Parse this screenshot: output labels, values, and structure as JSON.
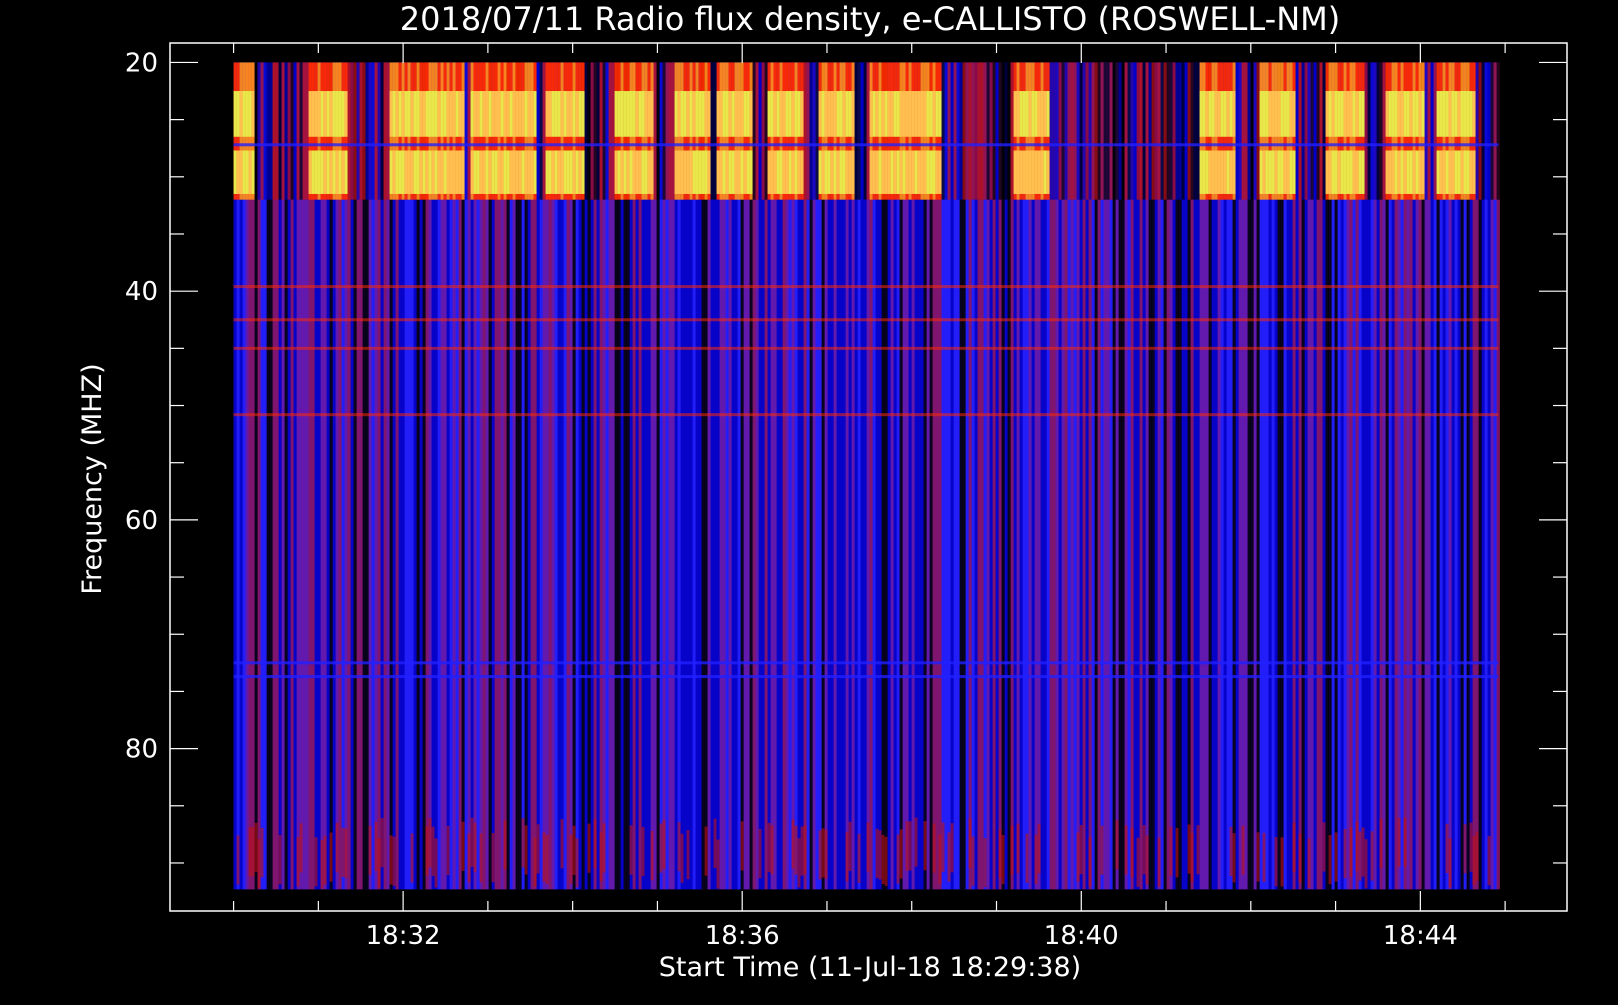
{
  "chart_data": {
    "type": "heatmap",
    "title": "2018/07/11  Radio flux density, e-CALLISTO (ROSWELL-NM)",
    "xlabel": "Start Time (11-Jul-18 18:29:38)",
    "ylabel": "Frequency (MHZ)",
    "x_tick_labels": [
      "18:32",
      "18:36",
      "18:40",
      "18:44"
    ],
    "x_ticks_minutes": [
      31.0,
      35.0,
      39.0,
      43.0
    ],
    "x_minor_ticks_minutes": [
      29.0,
      30.0,
      32.0,
      33.0,
      34.0,
      36.0,
      37.0,
      38.0,
      40.0,
      41.0,
      42.0,
      44.0
    ],
    "x_range_minutes": [
      28.25,
      44.73
    ],
    "data_x_range_minutes": [
      29.0,
      43.92
    ],
    "x_origin": "18:29:38",
    "y_tick_labels": [
      "20",
      "40",
      "60",
      "80"
    ],
    "y_ticks": [
      20,
      40,
      60,
      80
    ],
    "y_minor_ticks": [
      25,
      30,
      35,
      45,
      50,
      55,
      65,
      70,
      75,
      85,
      90
    ],
    "y_range": [
      18.3,
      94.2
    ],
    "data_y_range": [
      20,
      92.3
    ],
    "y_inverted": true,
    "grid": false,
    "legend": "none",
    "colormap": [
      "#000000",
      "#0000c8",
      "#2020ff",
      "#6a1aa8",
      "#8a1560",
      "#c01010",
      "#ff2a00",
      "#ff8a1a",
      "#ffc050",
      "#e8e84a"
    ],
    "features": {
      "bright_interference_bands_mhz": [
        [
          22.5,
          26.5
        ],
        [
          27.7,
          31.5
        ]
      ],
      "narrowband_rfi_lines_mhz": [
        27.2,
        39.6,
        42.5,
        45.0,
        50.8,
        72.5,
        73.7
      ],
      "bright_time_columns_minutes": [
        29.0,
        30.1,
        31.05,
        31.5,
        32.0,
        32.35,
        32.9,
        33.7,
        34.4,
        34.9,
        35.5,
        36.1,
        36.7,
        37.1,
        38.4,
        40.6,
        41.3,
        42.1,
        42.8,
        43.4
      ]
    }
  }
}
